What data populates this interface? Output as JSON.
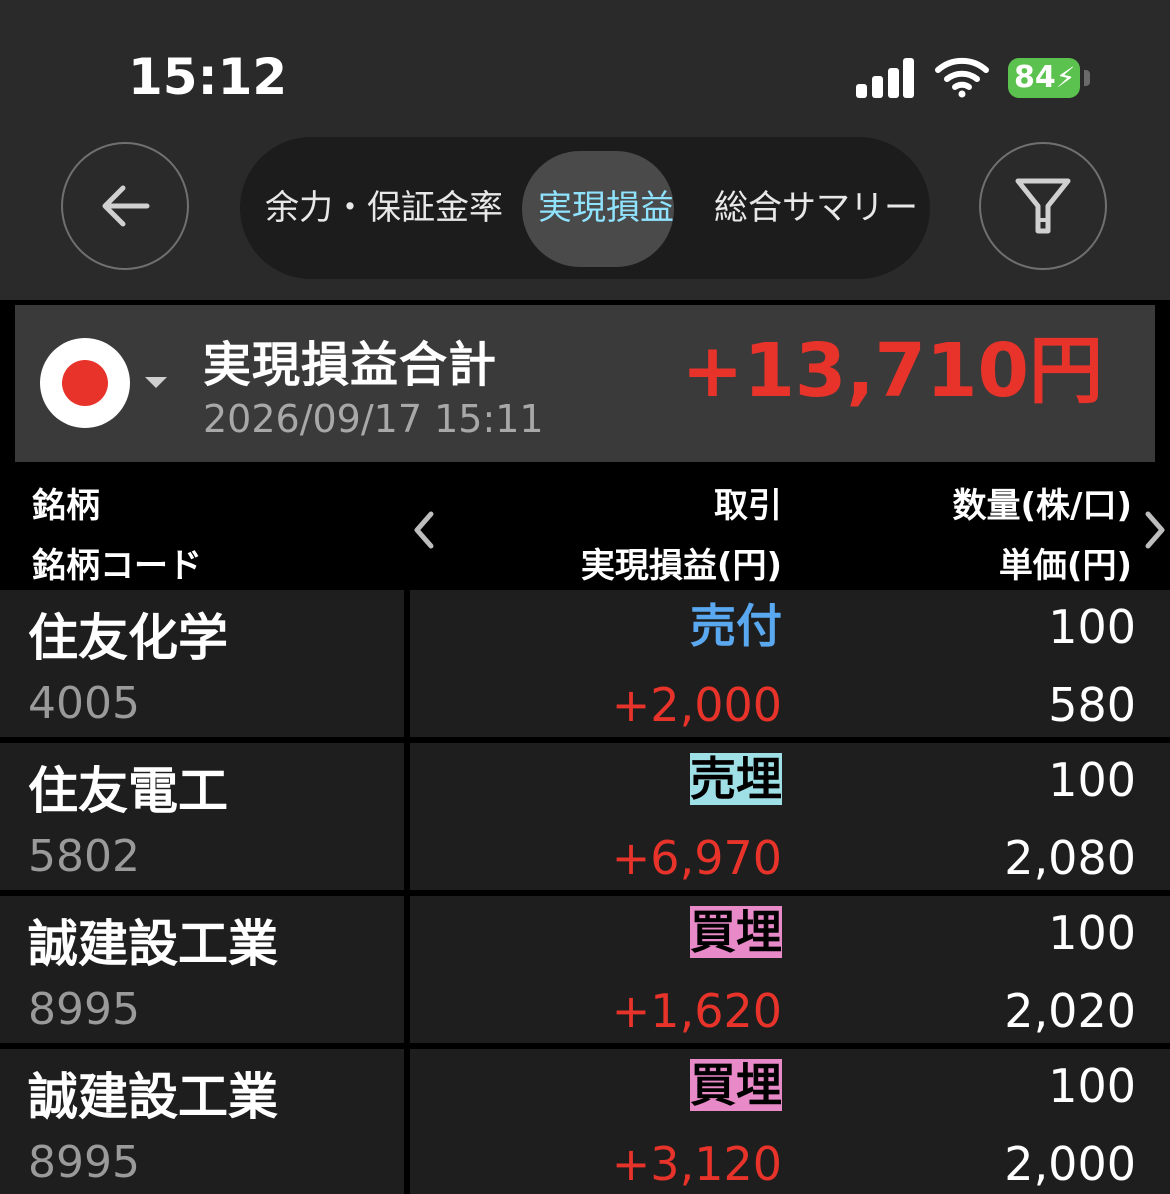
{
  "status_bar": {
    "time": "15:12",
    "battery": "84"
  },
  "nav": {
    "tabs": [
      {
        "label": "余力・保証金率"
      },
      {
        "label": "実現損益"
      },
      {
        "label": "総合サマリー"
      }
    ],
    "active_tab": 1
  },
  "summary": {
    "title": "実現損益合計",
    "datetime": "2026/09/17 15:11",
    "amount": "+13,710円"
  },
  "table": {
    "headers": {
      "col1_line1": "銘柄",
      "col1_line2": "銘柄コード",
      "col2_line1": "取引",
      "col2_line2": "実現損益(円)",
      "col3_line1": "数量(株/口)",
      "col3_line2": "単価(円)"
    },
    "rows": [
      {
        "name": "住友化学",
        "code": "4005",
        "trade": "売付",
        "pl": "+2,000",
        "qty": "100",
        "price": "580"
      },
      {
        "name": "住友電工",
        "code": "5802",
        "trade": "売埋",
        "pl": "+6,970",
        "qty": "100",
        "price": "2,080"
      },
      {
        "name": "誠建設工業",
        "code": "8995",
        "trade": "買埋",
        "pl": "+1,620",
        "qty": "100",
        "price": "2,020"
      },
      {
        "name": "誠建設工業",
        "code": "8995",
        "trade": "買埋",
        "pl": "+3,120",
        "qty": "100",
        "price": "2,000"
      }
    ]
  },
  "colors": {
    "profit": "#e8332a",
    "trade_sell_open": "#5aa8f0",
    "trade_sell_close_bg": "#9fe0e6",
    "trade_buy_close_bg": "#e88ac8",
    "active_tab": "#8fe3ff",
    "battery": "#5cc24f"
  },
  "icons": [
    "back-arrow-icon",
    "filter-icon",
    "japan-flag-icon",
    "chevron-left-icon",
    "chevron-right-icon",
    "cellular-signal-icon",
    "wifi-icon",
    "battery-charging-icon"
  ]
}
